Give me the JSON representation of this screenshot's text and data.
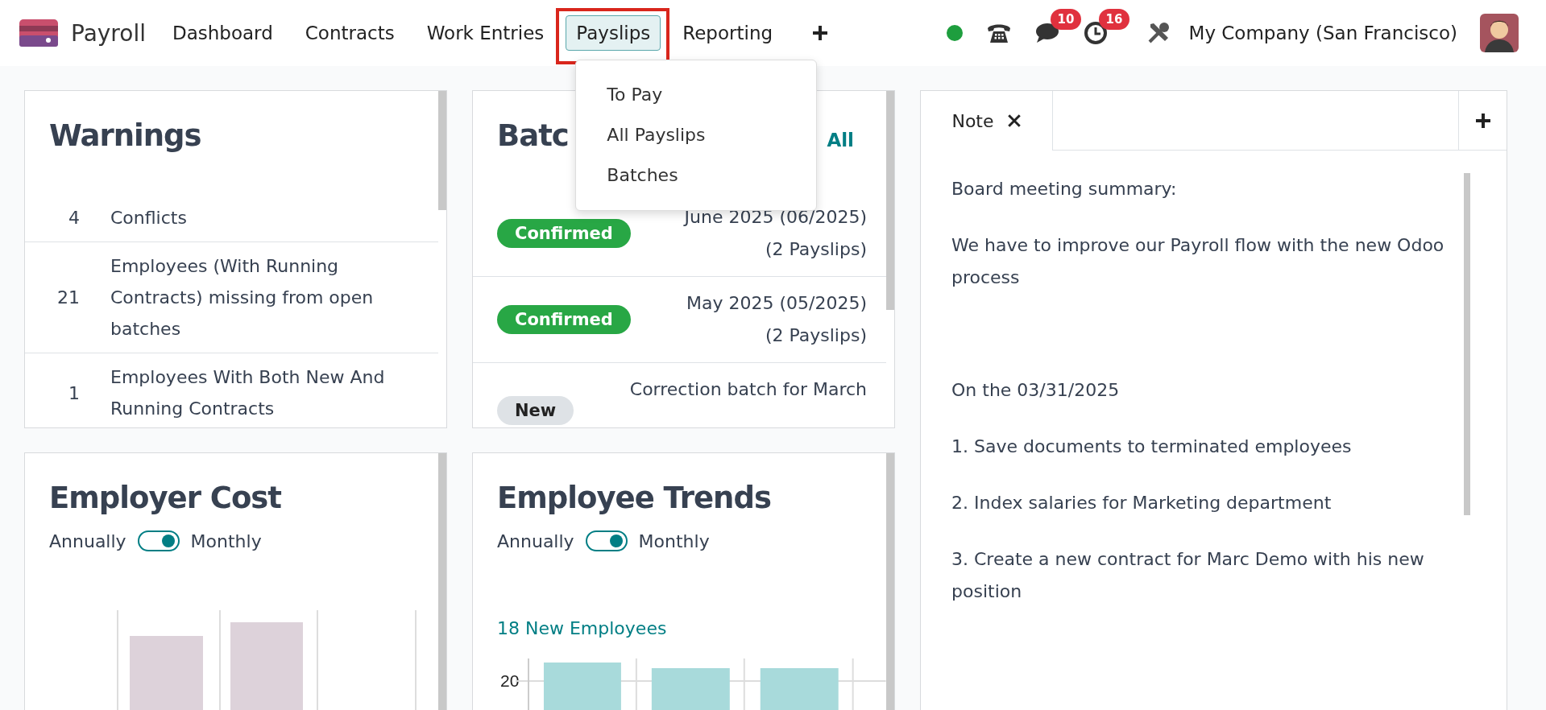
{
  "app": {
    "name": "Payroll"
  },
  "menu": [
    {
      "label": "Dashboard",
      "selected": false,
      "highlighted": false
    },
    {
      "label": "Contracts",
      "selected": false,
      "highlighted": false
    },
    {
      "label": "Work Entries",
      "selected": false,
      "highlighted": false
    },
    {
      "label": "Payslips",
      "selected": true,
      "highlighted": true
    },
    {
      "label": "Reporting",
      "selected": false,
      "highlighted": false
    }
  ],
  "dropdown": [
    "To Pay",
    "All Payslips",
    "Batches"
  ],
  "systray": {
    "chat_count": "10",
    "activity_count": "16",
    "company": "My Company (San Francisco)"
  },
  "warnings": {
    "title": "Warnings",
    "rows": [
      {
        "count": "4",
        "lines": [
          "Conflicts"
        ]
      },
      {
        "count": "21",
        "lines": [
          "Employees (With Running",
          "Contracts) missing from open",
          "batches"
        ]
      },
      {
        "count": "1",
        "lines": [
          "Employees With Both New And",
          "Running Contracts"
        ]
      }
    ]
  },
  "batches": {
    "title": "Batc",
    "link": "All",
    "rows": [
      {
        "status": "Confirmed",
        "kind": "confirmed",
        "lines": [
          "June 2025 (06/2025)",
          "(2 Payslips)"
        ]
      },
      {
        "status": "Confirmed",
        "kind": "confirmed",
        "lines": [
          "May 2025 (05/2025)",
          "(2 Payslips)"
        ]
      },
      {
        "status": "New",
        "kind": "new",
        "lines": [
          "Correction batch for March"
        ]
      }
    ]
  },
  "employer_cost": {
    "title": "Employer Cost",
    "toggle": {
      "left": "Annually",
      "right": "Monthly",
      "on": true
    }
  },
  "employee_trends": {
    "title": "Employee Trends",
    "toggle": {
      "left": "Annually",
      "right": "Monthly",
      "on": true
    },
    "summary": "18 New Employees",
    "y_tick": "20"
  },
  "note": {
    "tab": "Note",
    "sections": [
      [
        "Board meeting summary:",
        "We have to improve our Payroll flow with the new Odoo process"
      ],
      [
        "On the 03/31/2025",
        "1. Save documents to terminated employees",
        "2. Index salaries for Marketing department",
        "3. Create a new contract for Marc Demo with his new position"
      ]
    ]
  }
}
